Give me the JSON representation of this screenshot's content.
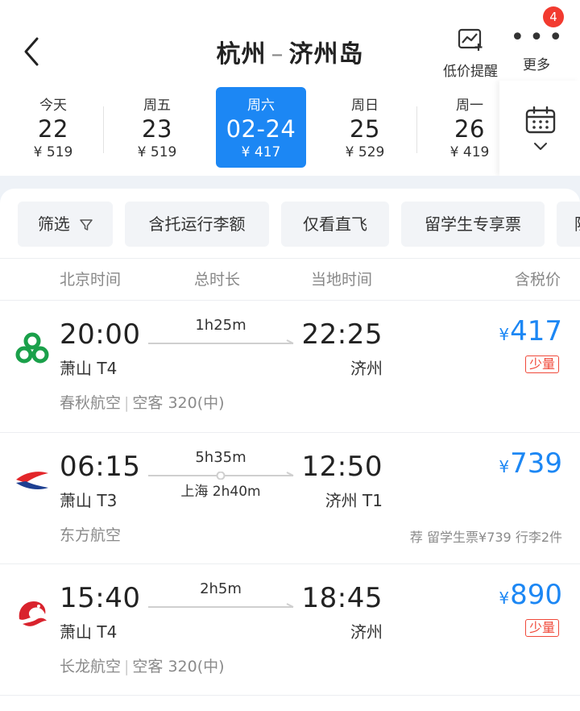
{
  "header": {
    "route_from": "杭州",
    "route_sep": "–",
    "route_to": "济州岛",
    "alert_label": "低价提醒",
    "more_label": "更多",
    "more_badge": "4"
  },
  "dates": [
    {
      "dow": "今天",
      "date": "22",
      "price": "¥ 519",
      "selected": false
    },
    {
      "dow": "周五",
      "date": "23",
      "price": "¥ 519",
      "selected": false
    },
    {
      "dow": "周六",
      "date": "02-24",
      "price": "¥ 417",
      "selected": true
    },
    {
      "dow": "周日",
      "date": "25",
      "price": "¥ 529",
      "selected": false
    },
    {
      "dow": "周一",
      "date": "26",
      "price": "¥ 419",
      "selected": false
    }
  ],
  "filters": {
    "filter_label": "筛选",
    "chip_baggage": "含托运行李额",
    "chip_direct": "仅看直飞",
    "chip_student": "留学生专享票",
    "chip_partial": "隐"
  },
  "columns": {
    "beijing_time": "北京时间",
    "duration": "总时长",
    "local_time": "当地时间",
    "price_incl_tax": "含税价"
  },
  "flights": [
    {
      "dep_time": "20:00",
      "dep_airport": "萧山 T4",
      "arr_time": "22:25",
      "arr_airport": "济州",
      "duration": "1h25m",
      "stopover": "",
      "currency": "¥",
      "price": "417",
      "tag": "少量",
      "airline": "春秋航空",
      "aircraft": "空客 320(中)",
      "recommend": ""
    },
    {
      "dep_time": "06:15",
      "dep_airport": "萧山 T3",
      "arr_time": "12:50",
      "arr_airport": "济州 T1",
      "duration": "5h35m",
      "stopover": "上海 2h40m",
      "currency": "¥",
      "price": "739",
      "tag": "",
      "airline": "东方航空",
      "aircraft": "",
      "recommend": "荐 留学生票¥739 行李2件"
    },
    {
      "dep_time": "15:40",
      "dep_airport": "萧山 T4",
      "arr_time": "18:45",
      "arr_airport": "济州",
      "duration": "2h5m",
      "stopover": "",
      "currency": "¥",
      "price": "890",
      "tag": "少量",
      "airline": "长龙航空",
      "aircraft": "空客 320(中)",
      "recommend": ""
    }
  ],
  "colors": {
    "accent": "#1c87f4",
    "badge": "#f23a2f",
    "tag": "#f0493a",
    "spring_airlines": "#1aa04a",
    "china_eastern_red": "#e3262a",
    "china_eastern_blue": "#1d3f91",
    "loong_air": "#d9232d"
  },
  "icons": [
    "back-arrow-icon",
    "price-alert-icon",
    "more-dots-icon",
    "calendar-icon",
    "chevron-down-icon",
    "filter-funnel-icon"
  ]
}
